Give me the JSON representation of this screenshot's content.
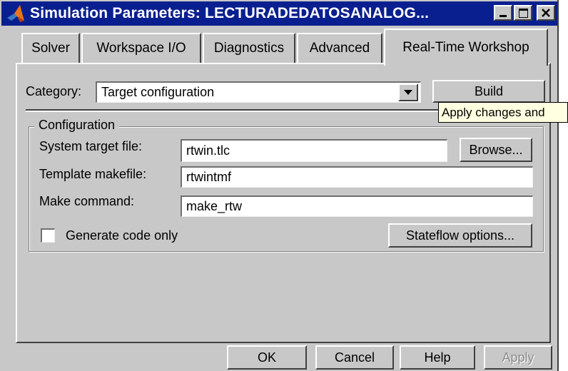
{
  "window": {
    "title": "Simulation Parameters: LECTURADEDATOSANALOG...",
    "accent_color": "#0a1f8f"
  },
  "titlebar_buttons": {
    "minimize_icon": "minimize-icon",
    "maximize_icon": "maximize-icon",
    "close_icon": "close-icon"
  },
  "tabs": [
    {
      "label": "Solver"
    },
    {
      "label": "Workspace I/O"
    },
    {
      "label": "Diagnostics"
    },
    {
      "label": "Advanced"
    },
    {
      "label": "Real-Time Workshop",
      "active": true
    }
  ],
  "category": {
    "label": "Category:",
    "value": "Target configuration",
    "build_label": "Build"
  },
  "tooltip": {
    "text": "Apply changes and"
  },
  "configuration": {
    "group_label": "Configuration",
    "system_target_label": "System target file:",
    "system_target_value": "rtwin.tlc",
    "browse_label": "Browse...",
    "template_label": "Template makefile:",
    "template_value": "rtwintmf",
    "make_label": "Make command:",
    "make_value": "make_rtw",
    "generate_code_label": "Generate code only",
    "generate_code_checked": false,
    "stateflow_label": "Stateflow options..."
  },
  "footer": {
    "ok_label": "OK",
    "cancel_label": "Cancel",
    "help_label": "Help",
    "apply_label": "Apply"
  }
}
